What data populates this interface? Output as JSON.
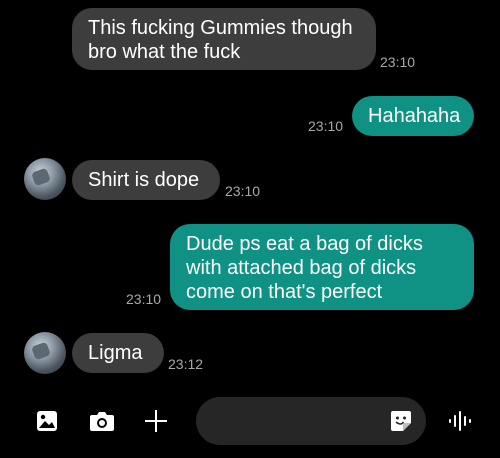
{
  "messages": [
    {
      "text": "This fucking Gummies though\nbro what the fuck",
      "time": "23:10",
      "direction": "in"
    },
    {
      "text": "Hahahaha",
      "time": "23:10",
      "direction": "out"
    },
    {
      "text": "Shirt is dope",
      "time": "23:10",
      "direction": "in"
    },
    {
      "text": "Dude ps eat a bag of dicks\nwith attached bag of dicks\ncome on that's perfect",
      "time": "23:10",
      "direction": "out"
    },
    {
      "text": "Ligma",
      "time": "23:12",
      "direction": "in"
    }
  ],
  "composer": {
    "placeholder": "",
    "icons": [
      "gallery-icon",
      "camera-icon",
      "plus-icon",
      "sticker-icon",
      "voice-icon"
    ]
  },
  "colors": {
    "incoming_bubble": "#3d3d3d",
    "outgoing_bubble": "#0f9184",
    "background": "#000000",
    "timestamp": "#a8a8a8"
  }
}
